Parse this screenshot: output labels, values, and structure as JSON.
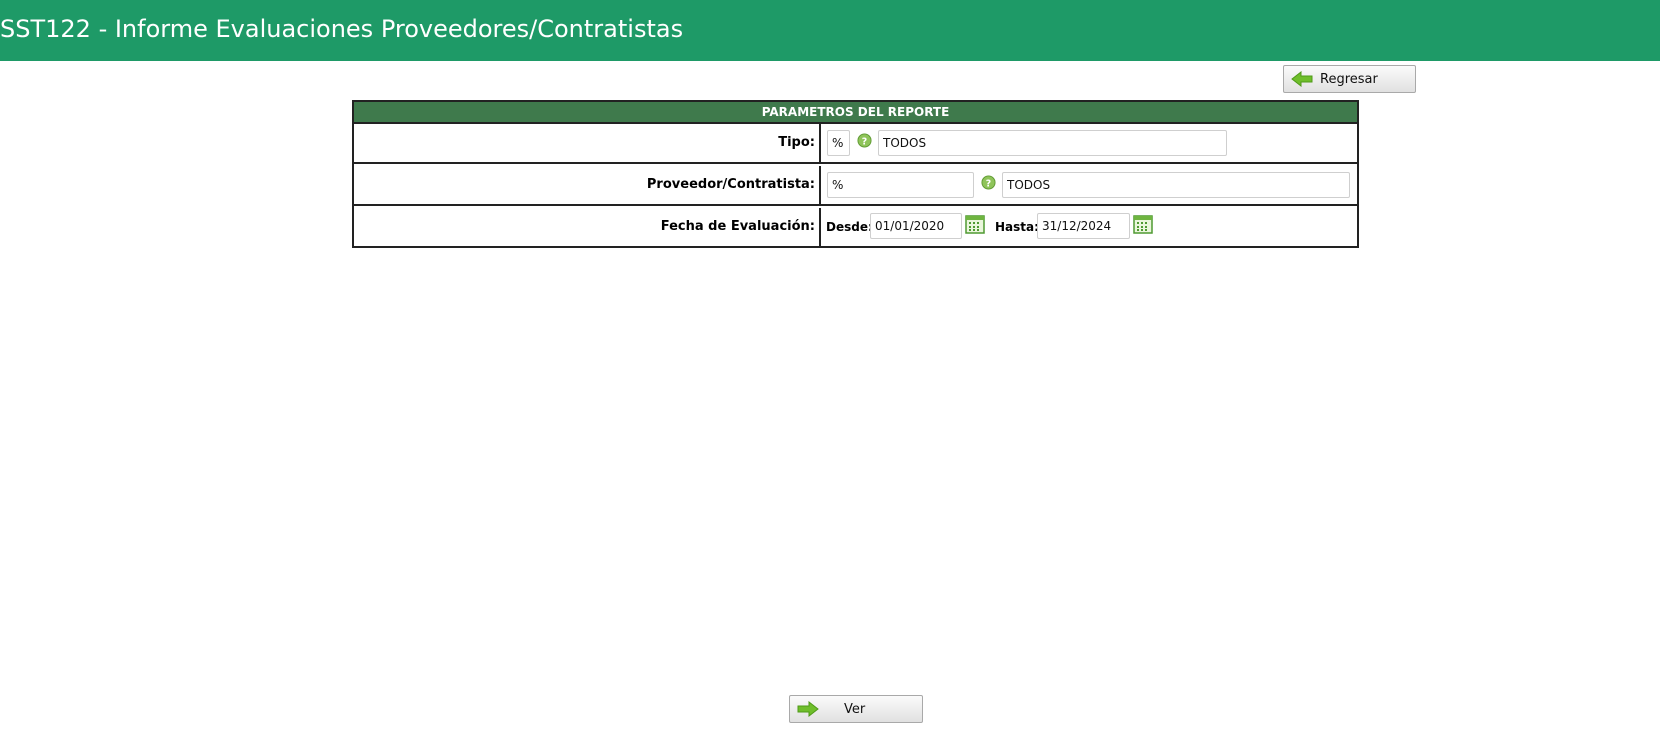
{
  "header": {
    "title": "SST122 - Informe Evaluaciones Proveedores/Contratistas"
  },
  "toolbar": {
    "back_label": "Regresar"
  },
  "params": {
    "heading": "PARAMETROS DEL REPORTE",
    "tipo": {
      "label": "Tipo:",
      "code": "%",
      "description": "TODOS"
    },
    "proveedor": {
      "label": "Proveedor/Contratista:",
      "code": "%",
      "description": "TODOS"
    },
    "fecha": {
      "label": "Fecha de Evaluación:",
      "desde_label": "Desde:",
      "desde": "01/01/2020",
      "hasta_label": "Hasta:",
      "hasta": "31/12/2024"
    }
  },
  "footer": {
    "view_label": "Ver"
  },
  "colors": {
    "header": "#1e9a67",
    "panel_head": "#3f7a4c",
    "arrow": "#6fbe2b"
  },
  "icons": [
    "arrow-left-icon",
    "help-icon",
    "calendar-icon",
    "arrow-right-icon"
  ]
}
